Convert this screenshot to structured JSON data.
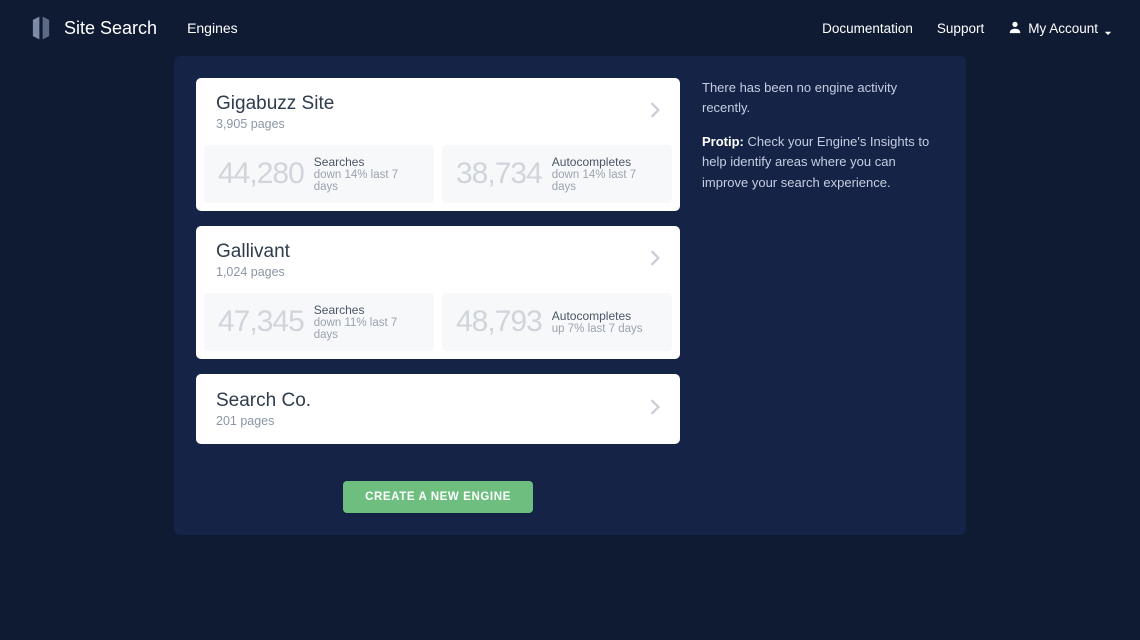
{
  "header": {
    "title": "Site Search",
    "nav": {
      "engines": "Engines"
    },
    "links": {
      "documentation": "Documentation",
      "support": "Support",
      "account": "My Account"
    }
  },
  "engines": [
    {
      "name": "Gigabuzz Site",
      "pages": "3,905 pages",
      "searches": {
        "value": "44,280",
        "label": "Searches",
        "change": "down 14% last 7 days"
      },
      "autocompletes": {
        "value": "38,734",
        "label": "Autocompletes",
        "change": "down 14% last 7 days"
      }
    },
    {
      "name": "Gallivant",
      "pages": "1,024 pages",
      "searches": {
        "value": "47,345",
        "label": "Searches",
        "change": "down 11% last 7 days"
      },
      "autocompletes": {
        "value": "48,793",
        "label": "Autocompletes",
        "change": "up 7% last 7 days"
      }
    },
    {
      "name": "Search Co.",
      "pages": "201 pages"
    }
  ],
  "sidebar": {
    "activity": "There has been no engine activity recently.",
    "protip_label": "Protip:",
    "protip_text": " Check your Engine's Insights to help identify areas where you can improve your search experience."
  },
  "actions": {
    "create": "CREATE A NEW ENGINE"
  }
}
